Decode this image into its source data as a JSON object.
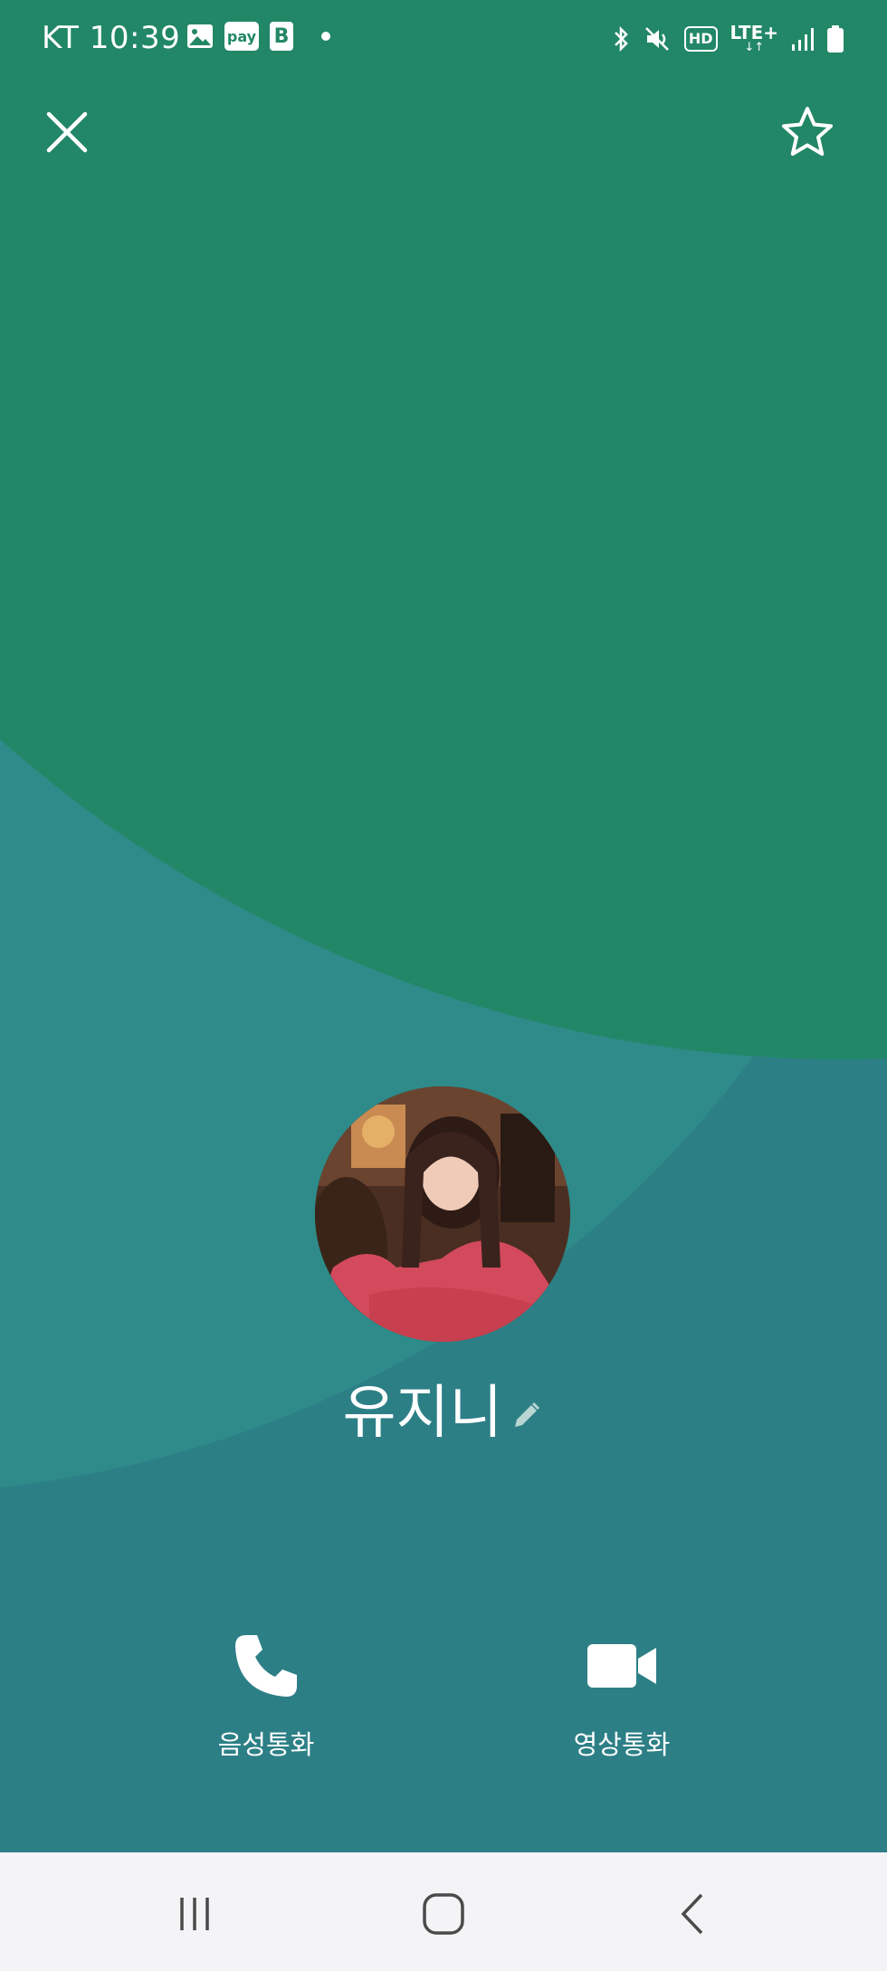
{
  "status_bar": {
    "carrier_time": "KT 10:39",
    "pay_label": "pay",
    "b_label": "B",
    "notification_icons": [
      "gallery-icon",
      "pay-icon",
      "b-app-icon",
      "dot-icon"
    ],
    "system_icons": [
      "bluetooth-icon",
      "mute-icon",
      "hd-icon",
      "lte-icon",
      "signal-icon",
      "battery-icon"
    ],
    "lte_label": "LTE+",
    "hd_label": "HD"
  },
  "colors": {
    "bg_top": "#228767",
    "bg_mid": "#2e8b89",
    "bg_bottom": "#2d7f86",
    "text": "#ffffff",
    "navbar": "#f4f4f6"
  },
  "header": {
    "close_icon": "close-icon",
    "favorite_icon": "star-outline-icon"
  },
  "profile": {
    "name": "유지니",
    "edit_icon": "pencil-icon"
  },
  "actions": [
    {
      "label": "음성통화",
      "icon": "phone-icon"
    },
    {
      "label": "영상통화",
      "icon": "video-camera-icon"
    }
  ],
  "navbar": {
    "buttons": [
      "recent-apps-icon",
      "home-icon",
      "back-icon"
    ]
  }
}
